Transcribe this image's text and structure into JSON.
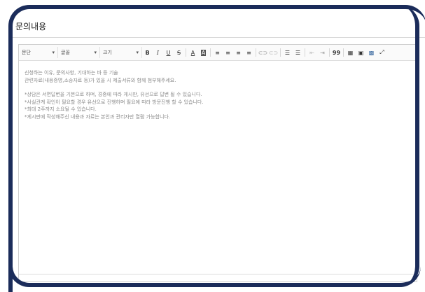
{
  "section": {
    "title": "문의내용"
  },
  "toolbar": {
    "paragraph": "문단",
    "font": "글꼴",
    "size": "크기",
    "bold": "B",
    "italic": "I",
    "underline": "U",
    "strike": "S",
    "font_color": "A",
    "bg_color": "A",
    "quote": "99"
  },
  "content": {
    "lines": [
      "신청하는 이유, 문의사항, 기대하는 바 등 기술",
      "관련자료(내용증명,소송자료 등)가 있을 시 제출서류와 함께 첨부해주세요.",
      "",
      "*상담은 서면답변을 기본으로 하며, 경중에 따라 게시판, 유선으로 답변 될 수 있습니다.",
      "*사실관계 확인이 필요할 경우 유선으로 진행하며 필요에 따라 방문진행 할 수 있습니다.",
      "*최대 2주까지 소요될 수 있습니다.",
      "*게시판에 작성해주신 내용과 자료는 본인과 관리자만 열람 가능합니다."
    ]
  }
}
